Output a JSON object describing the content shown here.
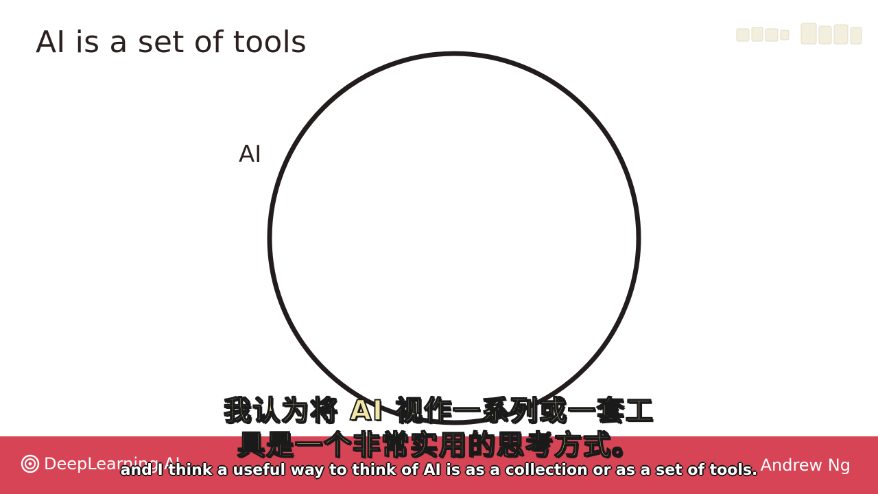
{
  "slide": {
    "title": "AI is a set of tools",
    "diagram_label": "AI",
    "brand_name": "DeepLearning.AI",
    "presenter": "Andrew Ng"
  },
  "subtitles": {
    "zh_line1": "我认为将 AI 视作一系列或一套工",
    "zh_line2": "具是一个非常实用的思考方式。",
    "en": "and I think a useful way to think of AI is as a collection or as a set of tools."
  },
  "colors": {
    "footer": "#d64455",
    "title_text": "#2b1f1f",
    "zh_subtitle": "#f3e7a6"
  },
  "icons": {
    "brand_logo": "deeplearning-logo-icon",
    "watermark": "channel-watermark-icon"
  }
}
